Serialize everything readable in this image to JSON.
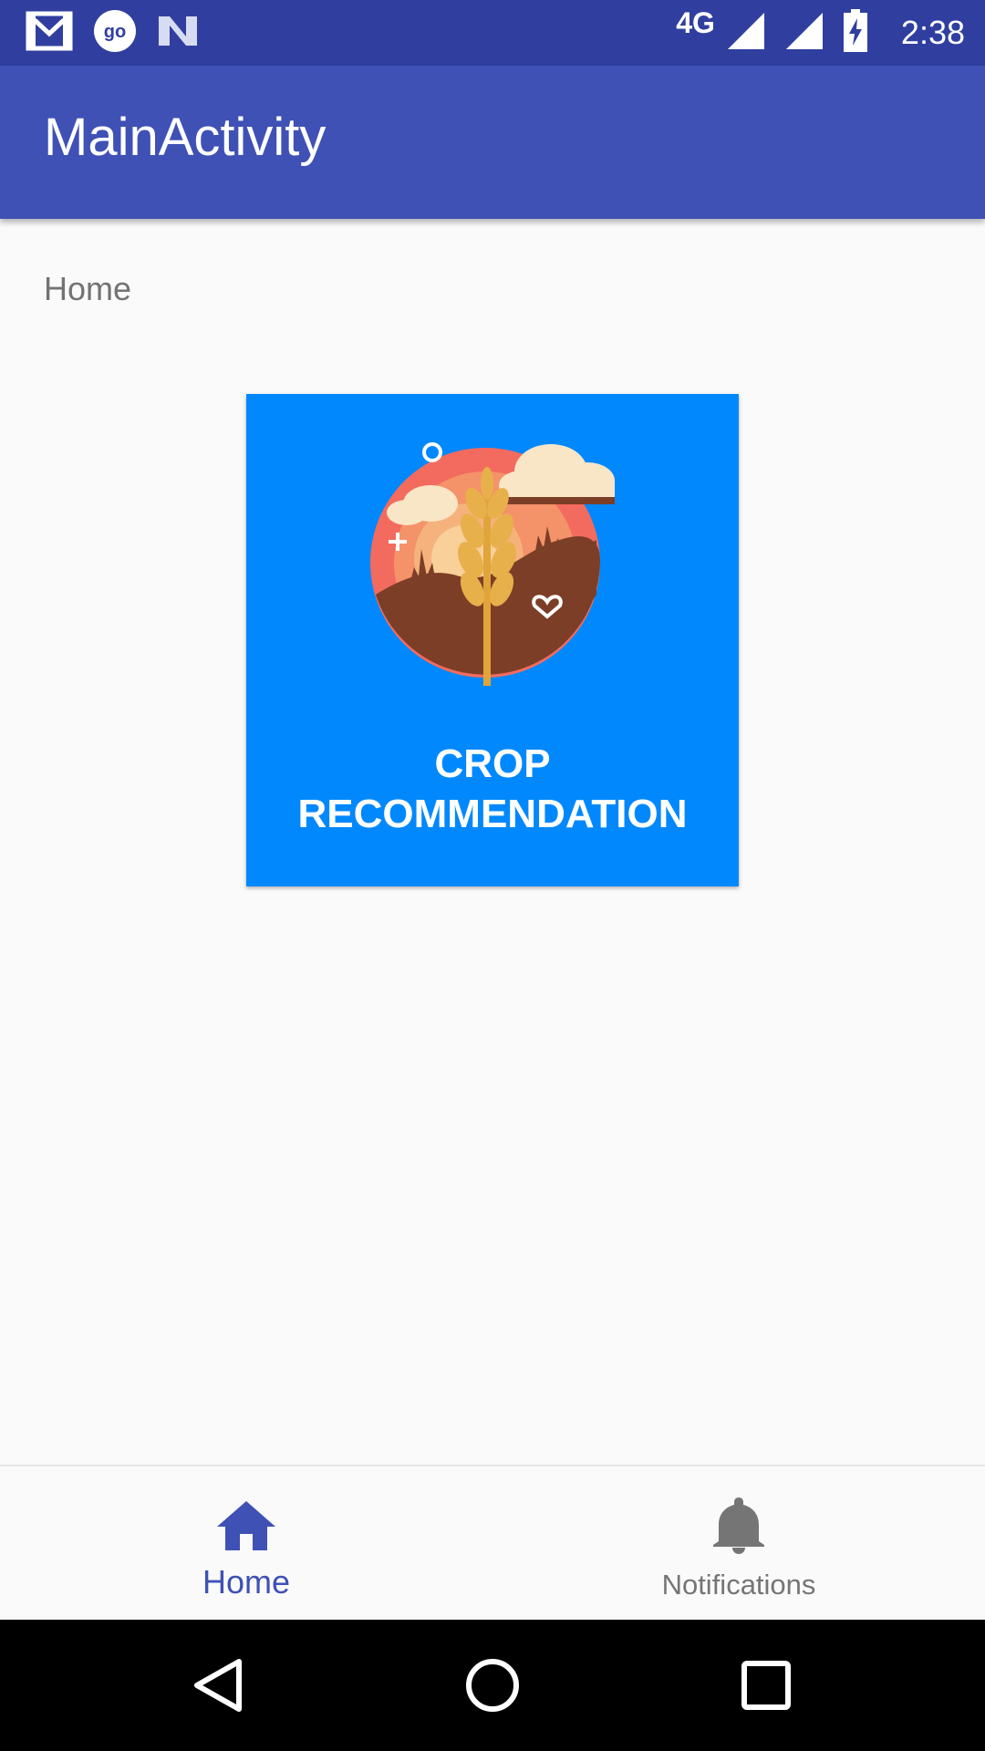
{
  "status_bar": {
    "notification_icons": [
      "gmail-icon",
      "go-app-icon",
      "n-app-icon"
    ],
    "network_type": "4G",
    "time": "2:38"
  },
  "app_bar": {
    "title": "MainActivity"
  },
  "main": {
    "section_label": "Home",
    "crop_card": {
      "label": "CROP\nRECOMMENDATION",
      "icon": "wheat-field-icon",
      "background_color": "#0188fd"
    }
  },
  "bottom_nav": {
    "items": [
      {
        "label": "Home",
        "icon": "home-icon",
        "active": true
      },
      {
        "label": "Notifications",
        "icon": "bell-icon",
        "active": false
      }
    ],
    "active_color": "#3f51b5",
    "inactive_color": "#757575"
  },
  "system_nav": {
    "buttons": [
      "back-icon",
      "home-circle-icon",
      "recents-icon"
    ]
  },
  "colors": {
    "primary": "#3f51b5",
    "primary_dark": "#303f9f",
    "background": "#fafafa"
  }
}
